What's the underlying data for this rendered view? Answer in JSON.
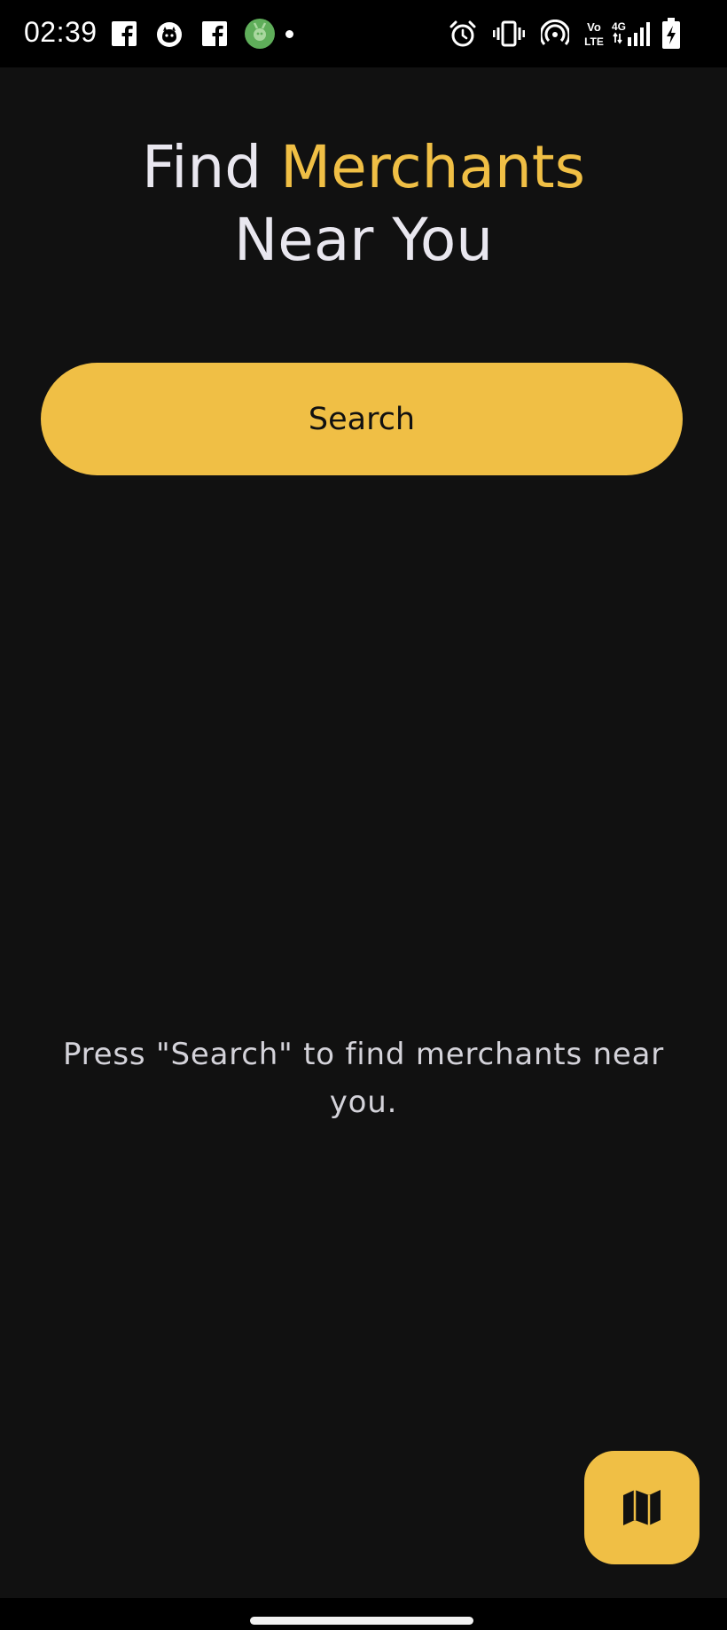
{
  "status_bar": {
    "time": "02:39",
    "notification_icons": [
      "facebook-icon",
      "cat-app-icon",
      "facebook-icon",
      "green-app-icon",
      "more-notifications-dot"
    ],
    "system_icons": [
      "alarm-icon",
      "vibrate-icon",
      "hotspot-icon",
      "volte-icon",
      "signal-4g-icon",
      "battery-charging-icon"
    ],
    "volte_label": "Vo LTE",
    "network_label": "4G"
  },
  "heading": {
    "line1_prefix": "Find",
    "line1_accent": "Merchants",
    "line2": "Near You"
  },
  "search_button": {
    "label": "Search"
  },
  "hint": {
    "text": "Press \"Search\" to find merchants near you."
  },
  "map_fab": {
    "icon": "map-icon"
  },
  "colors": {
    "background": "#111111",
    "accent": "#f0bf45",
    "text": "#e9e7ef"
  }
}
